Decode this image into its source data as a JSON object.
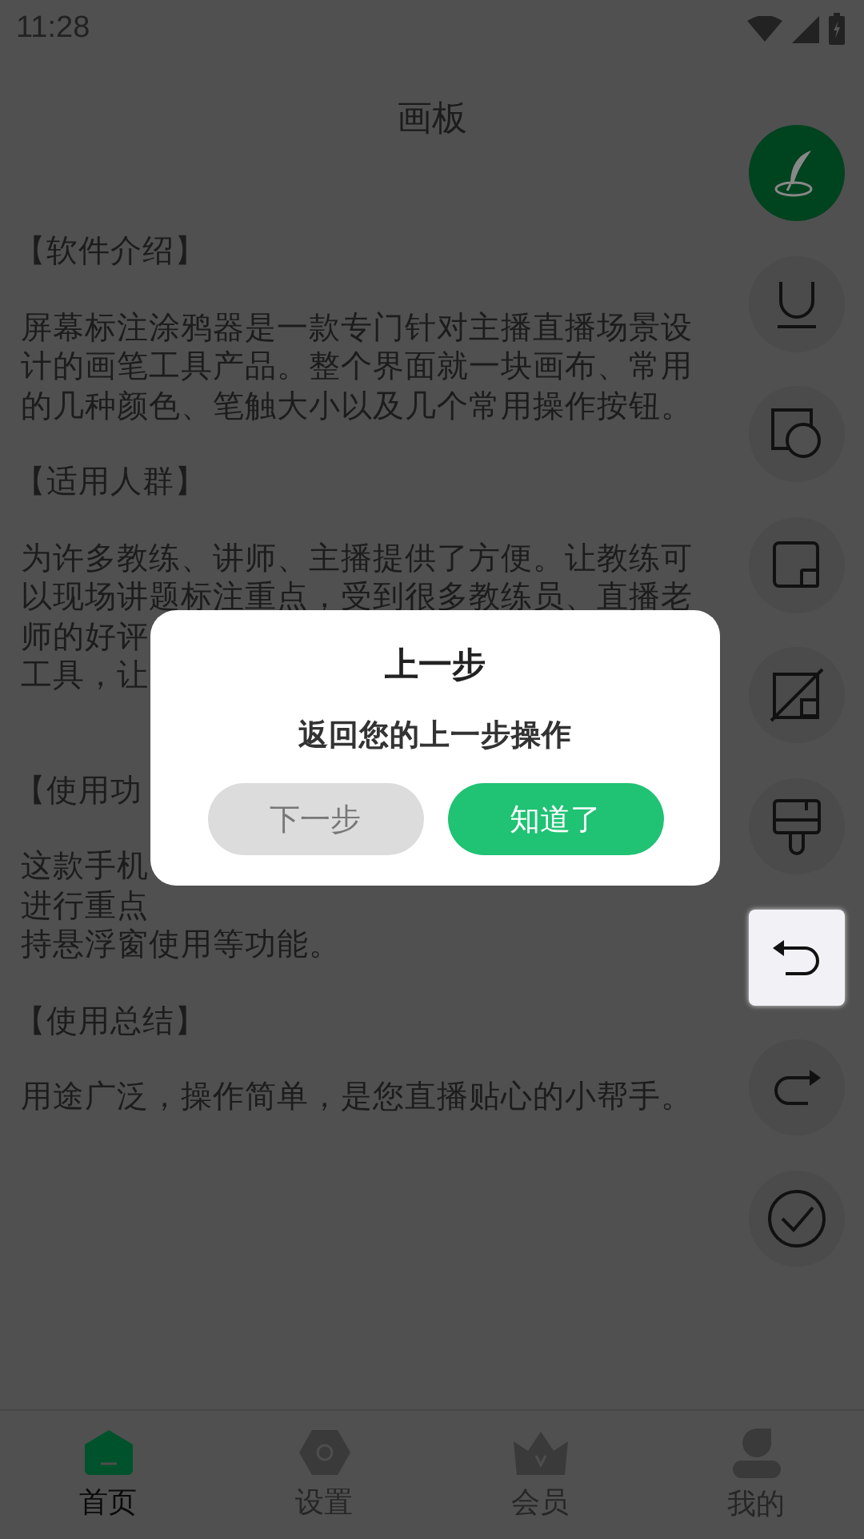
{
  "status_bar": {
    "time": "11:28"
  },
  "title": "画板",
  "blocks": [
    {
      "kind": "heading",
      "lines": [
        "【软件介绍】"
      ]
    },
    {
      "kind": "paragraph",
      "lines": [
        "屏幕标注涂鸦器是一款专门针对主播直播场景设",
        "计的画笔工具产品。整个界面就一块画布、常用",
        "的几种颜色、笔触大小以及几个常用操作按钮。"
      ]
    },
    {
      "kind": "heading",
      "lines": [
        "【适用人群】"
      ]
    },
    {
      "kind": "paragraph",
      "lines": [
        "为许多教练、讲师、主播提供了方便。让教练可",
        "以现场讲题标注重点，受到很多教练员、直播老",
        "师的好评",
        "工具，让"
      ]
    },
    {
      "kind": "heading",
      "lines": [
        "【使用功"
      ]
    },
    {
      "kind": "paragraph",
      "lines": [
        "这款手机",
        "进行重点",
        "持悬浮窗使用等功能。"
      ]
    },
    {
      "kind": "heading",
      "lines": [
        "【使用总结】"
      ]
    },
    {
      "kind": "paragraph",
      "lines": [
        "用途广泛，操作简单，是您直播贴心的小帮手。"
      ]
    }
  ],
  "tools": [
    {
      "kind": "pen",
      "selected": true,
      "highlighted": false
    },
    {
      "kind": "underline",
      "selected": false,
      "highlighted": false
    },
    {
      "kind": "shapes",
      "selected": false,
      "highlighted": false
    },
    {
      "kind": "square",
      "selected": false,
      "highlighted": false
    },
    {
      "kind": "eraser",
      "selected": false,
      "highlighted": false
    },
    {
      "kind": "brush",
      "selected": false,
      "highlighted": false
    },
    {
      "kind": "undo",
      "selected": false,
      "highlighted": true
    },
    {
      "kind": "redo",
      "selected": false,
      "highlighted": false
    },
    {
      "kind": "done",
      "selected": false,
      "highlighted": false
    }
  ],
  "dialog": {
    "title": "上一步",
    "message": "返回您的上一步操作",
    "buttons": [
      {
        "label": "下一步",
        "primary": false
      },
      {
        "label": "知道了",
        "primary": true
      }
    ]
  },
  "nav": [
    {
      "kind": "home",
      "label": "首页",
      "selected": true
    },
    {
      "kind": "settings",
      "label": "设置",
      "selected": false
    },
    {
      "kind": "vip",
      "label": "会员",
      "selected": false
    },
    {
      "kind": "profile",
      "label": "我的",
      "selected": false
    }
  ]
}
